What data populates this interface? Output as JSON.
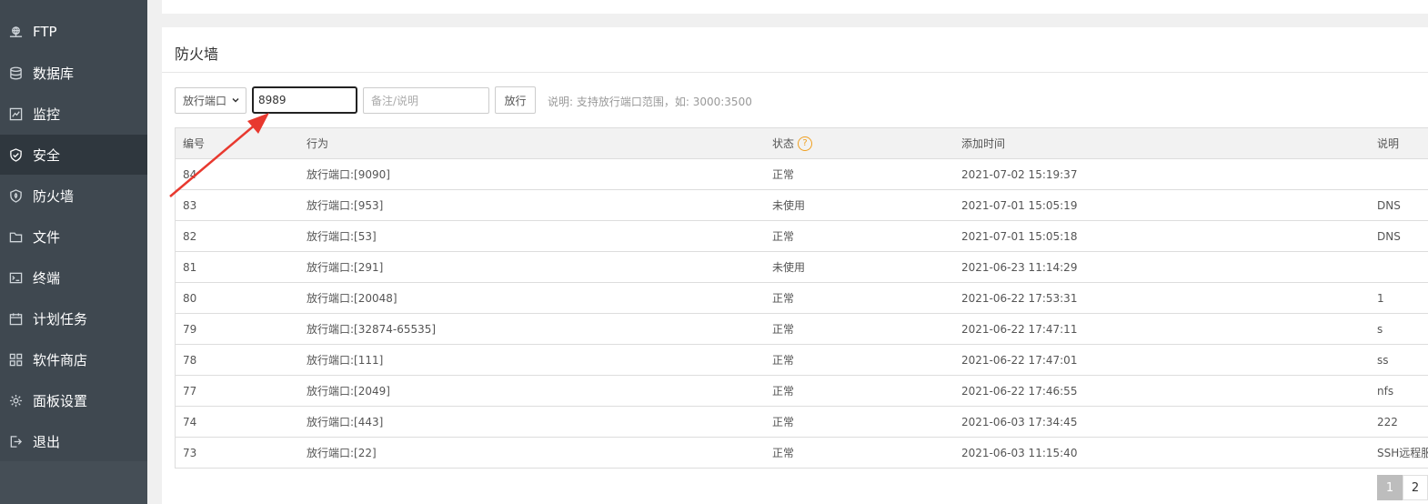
{
  "sidebar": {
    "items": [
      {
        "label": "FTP",
        "icon": "ftp-icon"
      },
      {
        "label": "数据库",
        "icon": "database-icon"
      },
      {
        "label": "监控",
        "icon": "monitor-icon"
      },
      {
        "label": "安全",
        "icon": "shield-icon",
        "active": true
      },
      {
        "label": "防火墙",
        "icon": "firewall-icon"
      },
      {
        "label": "文件",
        "icon": "folder-icon"
      },
      {
        "label": "终端",
        "icon": "terminal-icon"
      },
      {
        "label": "计划任务",
        "icon": "calendar-icon"
      },
      {
        "label": "软件商店",
        "icon": "grid-icon"
      },
      {
        "label": "面板设置",
        "icon": "gear-icon"
      },
      {
        "label": "退出",
        "icon": "logout-icon"
      }
    ]
  },
  "firewall": {
    "title": "防火墙",
    "select_value": "放行端口",
    "port_value": "8989",
    "note_placeholder": "备注/说明",
    "release_button": "放行",
    "hint": "说明: 支持放行端口范围，如: 3000:3500"
  },
  "table": {
    "headers": {
      "id": "编号",
      "action": "行为",
      "state": "状态",
      "time": "添加时间",
      "note": "说明"
    },
    "rows": [
      {
        "id": "84",
        "action": "放行端口:[9090]",
        "state": "正常",
        "time": "2021-07-02 15:19:37",
        "note": ""
      },
      {
        "id": "83",
        "action": "放行端口:[953]",
        "state": "未使用",
        "time": "2021-07-01 15:05:19",
        "note": "DNS"
      },
      {
        "id": "82",
        "action": "放行端口:[53]",
        "state": "正常",
        "time": "2021-07-01 15:05:18",
        "note": "DNS"
      },
      {
        "id": "81",
        "action": "放行端口:[291]",
        "state": "未使用",
        "time": "2021-06-23 11:14:29",
        "note": ""
      },
      {
        "id": "80",
        "action": "放行端口:[20048]",
        "state": "正常",
        "time": "2021-06-22 17:53:31",
        "note": "1"
      },
      {
        "id": "79",
        "action": "放行端口:[32874-65535]",
        "state": "正常",
        "time": "2021-06-22 17:47:11",
        "note": "s"
      },
      {
        "id": "78",
        "action": "放行端口:[111]",
        "state": "正常",
        "time": "2021-06-22 17:47:01",
        "note": "ss"
      },
      {
        "id": "77",
        "action": "放行端口:[2049]",
        "state": "正常",
        "time": "2021-06-22 17:46:55",
        "note": "nfs"
      },
      {
        "id": "74",
        "action": "放行端口:[443]",
        "state": "正常",
        "time": "2021-06-03 17:34:45",
        "note": "222"
      },
      {
        "id": "73",
        "action": "放行端口:[22]",
        "state": "正常",
        "time": "2021-06-03 11:15:40",
        "note": "SSH远程服"
      }
    ]
  },
  "pagination": {
    "current": "1",
    "next": "2"
  },
  "colors": {
    "sidebar_bg": "#3f4850",
    "sidebar_active": "#2f373e",
    "arrow": "#e8392f",
    "help_icon": "#f0a020"
  }
}
